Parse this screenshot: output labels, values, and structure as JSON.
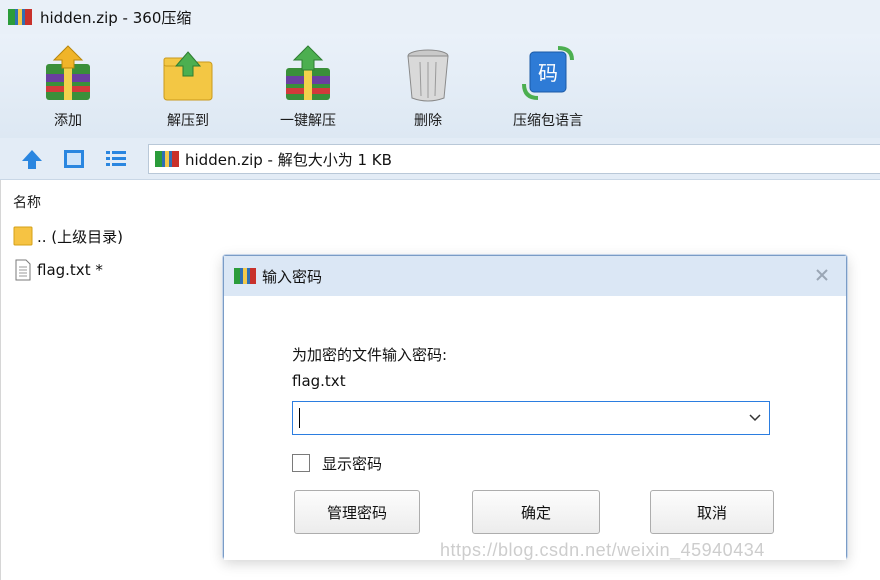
{
  "window": {
    "title": "hidden.zip - 360压缩",
    "app_icon": "zip-archive-icon"
  },
  "toolbar": {
    "items": [
      {
        "label": "添加",
        "icon": "add-archive-icon"
      },
      {
        "label": "解压到",
        "icon": "extract-to-icon"
      },
      {
        "label": "一键解压",
        "icon": "one-click-extract-icon"
      },
      {
        "label": "删除",
        "icon": "trash-bin-icon"
      },
      {
        "label": "压缩包语言",
        "icon": "archive-language-icon"
      }
    ]
  },
  "addressbar": {
    "path": "hidden.zip - 解包大小为 1 KB"
  },
  "filelist": {
    "column_name": "名称",
    "rows": [
      {
        "name": ".. (上级目录)",
        "icon": "folder-icon"
      },
      {
        "name": "flag.txt *",
        "icon": "text-file-icon"
      }
    ]
  },
  "dialog": {
    "title": "输入密码",
    "prompt": "为加密的文件输入密码:",
    "filename": "flag.txt",
    "password_value": "",
    "show_password_label": "显示密码",
    "buttons": {
      "manage": "管理密码",
      "ok": "确定",
      "cancel": "取消"
    }
  },
  "watermark": "https://blog.csdn.net/weixin_45940434",
  "colors": {
    "accent": "#2b7de0",
    "toolbar_bg": "#dde8f3",
    "title_bg": "#e9f0f8"
  }
}
